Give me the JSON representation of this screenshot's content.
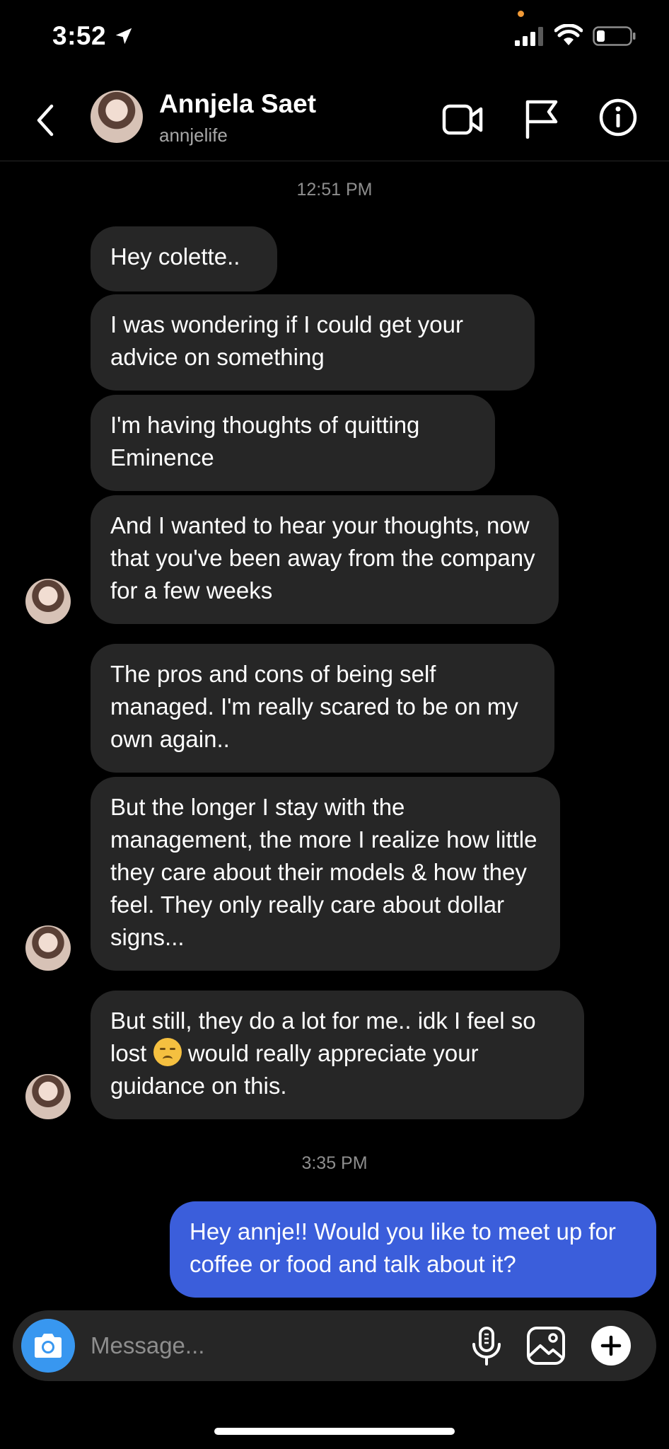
{
  "status_bar": {
    "time": "3:52"
  },
  "header": {
    "name": "Annjela Saet",
    "handle": "annjelife"
  },
  "thread": {
    "timestamp_1": "12:51 PM",
    "timestamp_2": "3:35 PM",
    "messages": [
      {
        "from": "them",
        "text": "Hey colette.."
      },
      {
        "from": "them",
        "text": "I was wondering if I could get your advice on something"
      },
      {
        "from": "them",
        "text": "I'm having thoughts of quitting Eminence"
      },
      {
        "from": "them",
        "text": "And I wanted to hear your thoughts, now that you've been away from the company for a few weeks"
      },
      {
        "from": "them",
        "text": "The pros and cons of being self managed. I'm really scared to be on my own again.."
      },
      {
        "from": "them",
        "text": "But the longer I stay with the management, the more I realize how little they care about their models & how they feel. They only really care about dollar signs..."
      },
      {
        "from": "them",
        "text_before_emoji": "But still, they do a lot for me.. idk I feel so lost",
        "emoji": "pensive-face",
        "text_after_emoji": "would really appreciate your guidance on this."
      },
      {
        "from": "me",
        "text": "Hey annje!! Would you like to meet up for coffee or food and talk about it?"
      }
    ]
  },
  "composer": {
    "placeholder": "Message..."
  },
  "colors": {
    "background": "#000000",
    "received_bubble": "#262626",
    "sent_bubble": "#3b5edb",
    "camera_button": "#3897f0",
    "timestamp": "#8e8e8e"
  }
}
